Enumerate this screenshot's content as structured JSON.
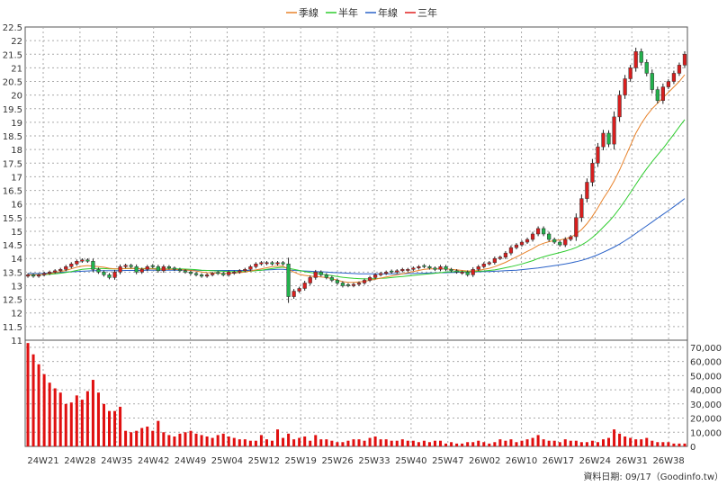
{
  "legend": [
    {
      "label": "季線",
      "color": "#e8822a"
    },
    {
      "label": "半年",
      "color": "#2ecc2e"
    },
    {
      "label": "年線",
      "color": "#2a62c8"
    },
    {
      "label": "三年",
      "color": "#e02020"
    }
  ],
  "footer": "資料日期: 09/17（Goodinfo.tw）",
  "chart_data": {
    "type": "candlestick",
    "price_axis": {
      "range": [
        11,
        22.5
      ],
      "ticks": [
        "11",
        "11.5",
        "12",
        "12.5",
        "13",
        "13.5",
        "14",
        "14.5",
        "15",
        "15.5",
        "16",
        "16.5",
        "17",
        "17.5",
        "18",
        "18.5",
        "19",
        "19.5",
        "20",
        "20.5",
        "21",
        "21.5",
        "22",
        "22.5"
      ]
    },
    "volume_axis": {
      "range": [
        0,
        75000
      ],
      "ticks": [
        "0",
        "10,000",
        "20,000",
        "30,000",
        "40,000",
        "50,000",
        "60,000",
        "70,000"
      ]
    },
    "x_labels": [
      "24W21",
      "24W28",
      "24W35",
      "24W42",
      "24W49",
      "25W04",
      "25W12",
      "25W19",
      "25W26",
      "25W33",
      "25W40",
      "25W47",
      "26W02",
      "26W10",
      "26W17",
      "26W24",
      "26W31",
      "26W38"
    ],
    "week_count": 122,
    "colors": {
      "up": "#d81e1e",
      "down": "#22b24c",
      "volume": "#e01010",
      "wick": "#222222"
    },
    "close": [
      13.4,
      13.35,
      13.4,
      13.45,
      13.5,
      13.55,
      13.6,
      13.7,
      13.8,
      13.9,
      13.95,
      13.9,
      13.6,
      13.5,
      13.4,
      13.3,
      13.5,
      13.7,
      13.75,
      13.7,
      13.5,
      13.6,
      13.7,
      13.7,
      13.55,
      13.7,
      13.65,
      13.6,
      13.55,
      13.5,
      13.45,
      13.4,
      13.35,
      13.4,
      13.45,
      13.45,
      13.4,
      13.5,
      13.5,
      13.55,
      13.6,
      13.7,
      13.8,
      13.85,
      13.85,
      13.8,
      13.85,
      13.8,
      12.6,
      12.8,
      12.9,
      13.1,
      13.3,
      13.5,
      13.4,
      13.3,
      13.2,
      13.1,
      13.0,
      13.0,
      13.05,
      13.1,
      13.2,
      13.3,
      13.4,
      13.45,
      13.5,
      13.5,
      13.55,
      13.6,
      13.6,
      13.65,
      13.7,
      13.7,
      13.65,
      13.6,
      13.7,
      13.6,
      13.55,
      13.5,
      13.5,
      13.4,
      13.6,
      13.7,
      13.8,
      13.85,
      14.0,
      14.05,
      14.2,
      14.4,
      14.5,
      14.6,
      14.7,
      14.9,
      15.1,
      14.9,
      14.7,
      14.6,
      14.5,
      14.7,
      14.8,
      15.5,
      16.2,
      16.8,
      17.5,
      18.1,
      18.6,
      18.2,
      19.2,
      20.0,
      20.6,
      21.0,
      21.6,
      21.2,
      20.8,
      20.2,
      19.8,
      20.3,
      20.5,
      20.8,
      21.1,
      21.5
    ],
    "ma_quarter": [
      13.4,
      13.4,
      13.4,
      13.42,
      13.45,
      13.48,
      13.52,
      13.56,
      13.62,
      13.68,
      13.72,
      13.74,
      13.72,
      13.7,
      13.68,
      13.64,
      13.62,
      13.62,
      13.63,
      13.64,
      13.63,
      13.62,
      13.62,
      13.62,
      13.6,
      13.6,
      13.6,
      13.6,
      13.59,
      13.58,
      13.56,
      13.54,
      13.5,
      13.48,
      13.47,
      13.46,
      13.45,
      13.46,
      13.47,
      13.48,
      13.5,
      13.54,
      13.58,
      13.62,
      13.66,
      13.7,
      13.72,
      13.72,
      13.6,
      13.5,
      13.42,
      13.38,
      13.35,
      13.34,
      13.32,
      13.3,
      13.26,
      13.2,
      13.15,
      13.12,
      13.12,
      13.14,
      13.16,
      13.2,
      13.24,
      13.28,
      13.32,
      13.36,
      13.4,
      13.44,
      13.48,
      13.52,
      13.56,
      13.6,
      13.62,
      13.62,
      13.62,
      13.62,
      13.6,
      13.58,
      13.56,
      13.54,
      13.54,
      13.56,
      13.6,
      13.64,
      13.7,
      13.78,
      13.86,
      13.96,
      14.06,
      14.16,
      14.26,
      14.36,
      14.48,
      14.56,
      14.62,
      14.66,
      14.68,
      14.72,
      14.78,
      14.9,
      15.06,
      15.28,
      15.55,
      15.86,
      16.2,
      16.5,
      16.85,
      17.25,
      17.7,
      18.15,
      18.6,
      18.95,
      19.25,
      19.5,
      19.7,
      19.9,
      20.1,
      20.3,
      20.5,
      20.75
    ],
    "ma_half": [
      13.4,
      13.4,
      13.4,
      13.41,
      13.42,
      13.44,
      13.46,
      13.49,
      13.52,
      13.56,
      13.6,
      13.62,
      13.63,
      13.63,
      13.63,
      13.62,
      13.62,
      13.62,
      13.63,
      13.63,
      13.63,
      13.63,
      13.63,
      13.63,
      13.62,
      13.62,
      13.62,
      13.62,
      13.62,
      13.61,
      13.6,
      13.59,
      13.57,
      13.56,
      13.55,
      13.54,
      13.53,
      13.52,
      13.52,
      13.52,
      13.52,
      13.53,
      13.55,
      13.57,
      13.6,
      13.63,
      13.66,
      13.68,
      13.64,
      13.6,
      13.56,
      13.52,
      13.49,
      13.46,
      13.43,
      13.4,
      13.37,
      13.34,
      13.31,
      13.29,
      13.27,
      13.26,
      13.25,
      13.25,
      13.26,
      13.27,
      13.28,
      13.3,
      13.32,
      13.34,
      13.36,
      13.38,
      13.4,
      13.42,
      13.44,
      13.46,
      13.48,
      13.5,
      13.51,
      13.52,
      13.52,
      13.52,
      13.52,
      13.53,
      13.54,
      13.56,
      13.58,
      13.62,
      13.66,
      13.7,
      13.75,
      13.8,
      13.86,
      13.92,
      14.0,
      14.06,
      14.12,
      14.17,
      14.22,
      14.27,
      14.33,
      14.4,
      14.5,
      14.62,
      14.77,
      14.95,
      15.15,
      15.35,
      15.58,
      15.84,
      16.12,
      16.42,
      16.72,
      17.02,
      17.3,
      17.56,
      17.8,
      18.04,
      18.3,
      18.56,
      18.84,
      19.1
    ],
    "ma_year": [
      13.45,
      13.45,
      13.45,
      13.46,
      13.47,
      13.48,
      13.49,
      13.5,
      13.51,
      13.52,
      13.53,
      13.54,
      13.55,
      13.55,
      13.55,
      13.55,
      13.55,
      13.55,
      13.56,
      13.56,
      13.56,
      13.56,
      13.57,
      13.57,
      13.57,
      13.57,
      13.57,
      13.57,
      13.57,
      13.57,
      13.57,
      13.57,
      13.56,
      13.56,
      13.56,
      13.56,
      13.56,
      13.56,
      13.56,
      13.56,
      13.56,
      13.56,
      13.57,
      13.57,
      13.58,
      13.59,
      13.6,
      13.6,
      13.58,
      13.56,
      13.55,
      13.54,
      13.53,
      13.52,
      13.51,
      13.5,
      13.49,
      13.48,
      13.47,
      13.46,
      13.45,
      13.44,
      13.44,
      13.44,
      13.44,
      13.44,
      13.44,
      13.44,
      13.44,
      13.44,
      13.45,
      13.45,
      13.46,
      13.46,
      13.47,
      13.47,
      13.48,
      13.48,
      13.49,
      13.49,
      13.5,
      13.5,
      13.51,
      13.51,
      13.52,
      13.52,
      13.53,
      13.54,
      13.55,
      13.56,
      13.57,
      13.59,
      13.61,
      13.63,
      13.65,
      13.68,
      13.71,
      13.74,
      13.77,
      13.8,
      13.84,
      13.88,
      13.93,
      13.99,
      14.06,
      14.14,
      14.23,
      14.32,
      14.42,
      14.53,
      14.65,
      14.78,
      14.92,
      15.06,
      15.2,
      15.34,
      15.48,
      15.62,
      15.76,
      15.9,
      16.05,
      16.2
    ],
    "volume": [
      73000,
      65000,
      58000,
      51000,
      45000,
      41000,
      38000,
      30000,
      31000,
      36000,
      33000,
      39000,
      47000,
      38000,
      30000,
      25000,
      25000,
      28000,
      11000,
      10000,
      11000,
      13000,
      14000,
      11000,
      18000,
      10000,
      8000,
      7000,
      9000,
      10000,
      11000,
      9000,
      8000,
      7000,
      6000,
      8000,
      9000,
      7000,
      6000,
      5000,
      5000,
      4000,
      4000,
      8000,
      5000,
      4000,
      12000,
      6000,
      9000,
      5000,
      6000,
      7000,
      4000,
      8000,
      5000,
      5000,
      4000,
      3000,
      3000,
      4000,
      5000,
      5000,
      4000,
      6000,
      7000,
      5000,
      5000,
      4000,
      4000,
      5000,
      4000,
      4000,
      3000,
      4000,
      3000,
      4000,
      4000,
      2000,
      3000,
      2000,
      2000,
      3000,
      3000,
      4000,
      3000,
      2000,
      3000,
      5000,
      4000,
      5000,
      3000,
      4000,
      5000,
      6000,
      8000,
      5000,
      4000,
      4000,
      3000,
      5000,
      4000,
      4000,
      3000,
      3000,
      4000,
      3000,
      5000,
      6000,
      12000,
      9000,
      7000,
      6000,
      5000,
      5000,
      6000,
      4000,
      3000,
      3000,
      3000,
      2000,
      2000,
      2000
    ]
  }
}
